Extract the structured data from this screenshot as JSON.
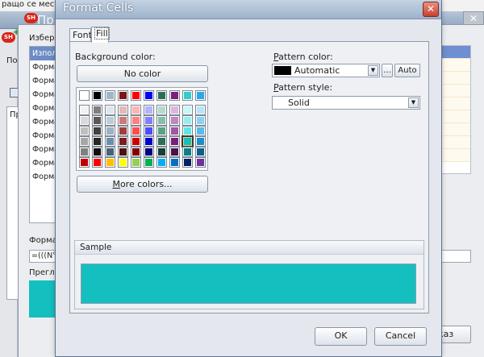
{
  "background": {
    "top_text": "ращо се местоп",
    "window_title": "Пр",
    "list_header": "Избери",
    "side_label": "Пок",
    "tab_label": "Пр",
    "list_items": [
      "Изпол",
      "Форма",
      "Форма",
      "Форма",
      "Форма",
      "Форма",
      "Форма",
      "Форма",
      "Форма",
      "Форма"
    ],
    "format_label": "Формат",
    "format_value": "=(((N°",
    "preview_label": "Прегле",
    "preview_color": "#13bfbf",
    "right_button": "каз",
    "close_glyph": "✕"
  },
  "dialog": {
    "title": "Format Cells",
    "close_glyph": "✕",
    "tabs": [
      {
        "label": "Font",
        "active": false
      },
      {
        "label": "Fill",
        "active": true
      }
    ],
    "background_color": {
      "label": "Background color:",
      "no_color_button": "No color",
      "more_colors_prefix": "",
      "more_colors_accel": "M",
      "more_colors_rest": "ore colors...",
      "selected_color": "#13bfbf"
    },
    "pattern_color": {
      "label_accel": "P",
      "label_rest": "attern color:",
      "value": "Automatic",
      "value_color": "#000000",
      "ellipsis_button": "...",
      "auto_button": "Auto",
      "dropdown_icon": "chevron-down-icon"
    },
    "pattern_style": {
      "label_accel": "P",
      "label_rest": "attern style:",
      "value": "Solid",
      "dropdown_icon": "chevron-down-icon"
    },
    "sample": {
      "label": "Sample",
      "color": "#13bfbf"
    },
    "ok_button": "OK",
    "cancel_button": "Cancel"
  },
  "palette": {
    "top_row": [
      "#ffffff",
      "#000000",
      "#9fb6c8",
      "#7f1414",
      "#ff0000",
      "#0000ff",
      "#2e6e58",
      "#7a1f7a",
      "#33cccc",
      "#2aa8e8"
    ],
    "columns": [
      [
        "#f2f2f2",
        "#d9d9d9",
        "#bfbfbf",
        "#a6a6a6",
        "#808080"
      ],
      [
        "#7f7f7f",
        "#595959",
        "#404040",
        "#262626",
        "#0d0d0d"
      ],
      [
        "#dde6ed",
        "#bccdda",
        "#9ab3c7",
        "#6d8ea8",
        "#46627a"
      ],
      [
        "#e6b8b8",
        "#cc7a7a",
        "#a33d3d",
        "#7a1f1f",
        "#4d0f0f"
      ],
      [
        "#ffb3b3",
        "#ff8080",
        "#ff4d4d",
        "#cc0000",
        "#800000"
      ],
      [
        "#b3b3ff",
        "#8080ff",
        "#4d4dff",
        "#0000cc",
        "#000080"
      ],
      [
        "#b6d9cc",
        "#86bfa9",
        "#56a386",
        "#2e6e58",
        "#1a3f32"
      ],
      [
        "#dcb6dc",
        "#c086c0",
        "#a356a3",
        "#7a1f7a",
        "#4a124a"
      ],
      [
        "#c9f7f7",
        "#93efef",
        "#5ce6e6",
        "#13bfbf",
        "#0b8080"
      ],
      [
        "#b8e3f8",
        "#8ad1f2",
        "#55bcec",
        "#1b8fc6",
        "#0e5f86"
      ]
    ],
    "bottom_row": [
      "#c00000",
      "#ff0000",
      "#ffc000",
      "#ffff00",
      "#92d050",
      "#00b050",
      "#00b0f0",
      "#0070c0",
      "#002060",
      "#7030a0"
    ],
    "selected": {
      "column": 8,
      "row": 3
    }
  }
}
